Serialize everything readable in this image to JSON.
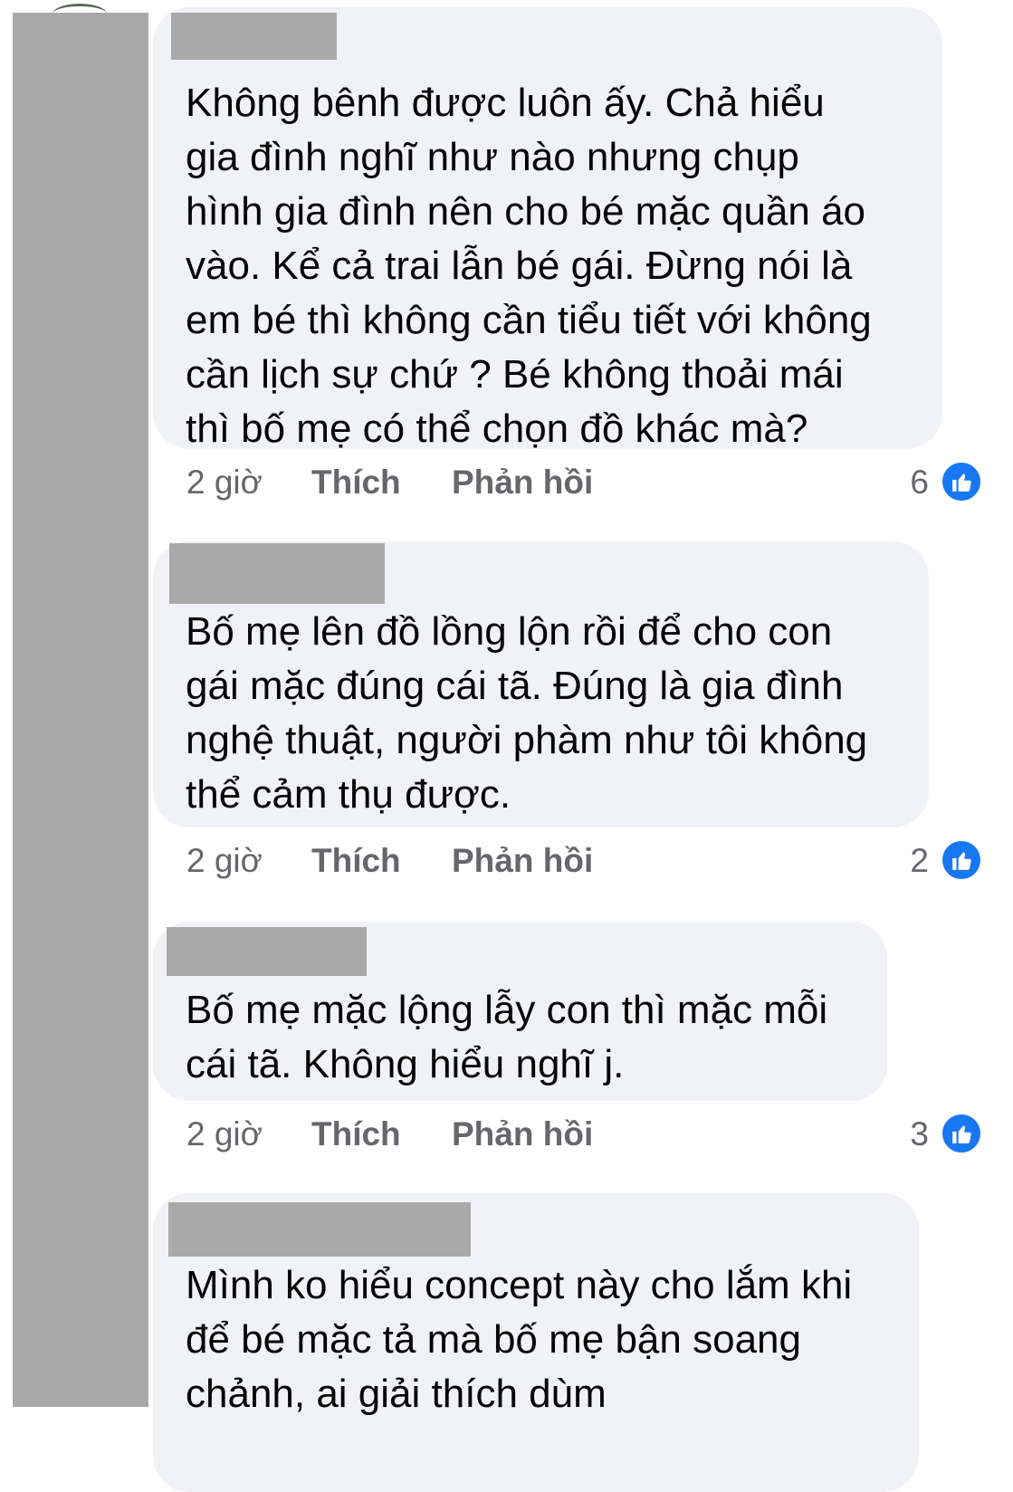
{
  "comments": [
    {
      "text": "Không bênh được luôn ấy. Chả hiểu\ngia đình nghĩ như nào nhưng chụp\nhình gia đình nên cho bé mặc quần áo\nvào. Kể cả trai lẫn bé gái. Đừng nói là\nem bé thì không cần tiểu tiết với không\ncần lịch sự chứ ? Bé không thoải mái\nthì bố mẹ có thể chọn đồ khác mà?",
      "time": "2 giờ",
      "like_label": "Thích",
      "reply_label": "Phản hồi",
      "reaction_count": "6"
    },
    {
      "text": "Bố mẹ lên đồ lồng lộn rồi để cho con\ngái mặc đúng cái tã. Đúng là gia đình\nnghệ thuật, người phàm như tôi không\nthể cảm thụ được.",
      "time": "2 giờ",
      "like_label": "Thích",
      "reply_label": "Phản hồi",
      "reaction_count": "2"
    },
    {
      "text": "Bố mẹ mặc lộng lẫy con thì mặc mỗi\ncái tã. Không hiểu nghĩ j.",
      "time": "2 giờ",
      "like_label": "Thích",
      "reply_label": "Phản hồi",
      "reaction_count": "3"
    },
    {
      "text": "Mình ko hiểu concept này cho lắm khi\nđể bé mặc tả mà bố mẹ bận soang\nchảnh, ai giải thích dùm"
    }
  ],
  "colors": {
    "bubble": "#f0f2f5",
    "redaction": "#a9a9a9",
    "meta_text": "#65676b",
    "like_blue": "#1877f2"
  },
  "icons": {
    "reaction": "like-thumbs-up-icon"
  }
}
